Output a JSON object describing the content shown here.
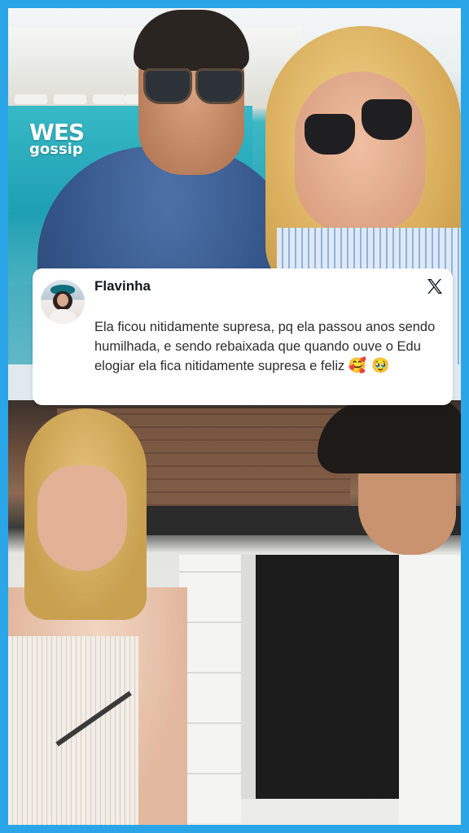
{
  "logo": {
    "line1": "WES",
    "line2": "gossip"
  },
  "tweet": {
    "author": "Flavinha",
    "platform_icon": "x-logo-icon",
    "text": "Ela ficou nitidamente supresa, pq ela passou anos sendo humilhada, e sendo rebaixada que quando ouve o Edu elogiar ela fica nitidamente supresa e feliz",
    "emojis": "🥰 🥹"
  },
  "colors": {
    "border": "#2aa6e8",
    "card": "#ffffff",
    "text": "#2d2d2d"
  }
}
